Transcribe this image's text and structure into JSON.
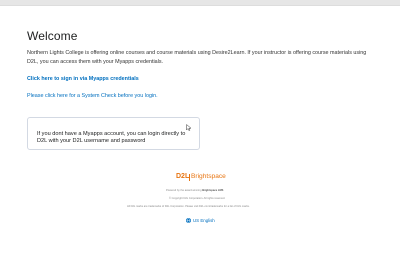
{
  "page": {
    "title": "Welcome"
  },
  "intro": {
    "text": "Northern Lights College is offering online courses and course materials using Desire2Learn. If your instructor is offering course materials using D2L, you can access them with your Myapps credentials."
  },
  "links": {
    "signin": "Click here to sign in via Myapps credentials",
    "system_check": "Please click here for a System Check before you login."
  },
  "login_box": {
    "text": "If you dont have a Myapps account, you can login directly to D2L with your D2L username and password"
  },
  "brand": {
    "d2l": "D2L",
    "name": "Brightspace",
    "color": "#e87511"
  },
  "footer": {
    "powered_prefix": "Powered by the award-winning",
    "powered_product": "Brightspace LMS",
    "copyright": "© Copyright D2L Corporation. All rights reserved.",
    "trademark": "All D2L marks are trademarks of D2L Corporation. Please visit D2L.com/trademarks for a list of D2L marks.",
    "language": "US English"
  },
  "colors": {
    "link": "#006fbf",
    "text": "#202122"
  },
  "icons": {
    "cursor": "cursor-icon",
    "globe": "globe-icon"
  }
}
